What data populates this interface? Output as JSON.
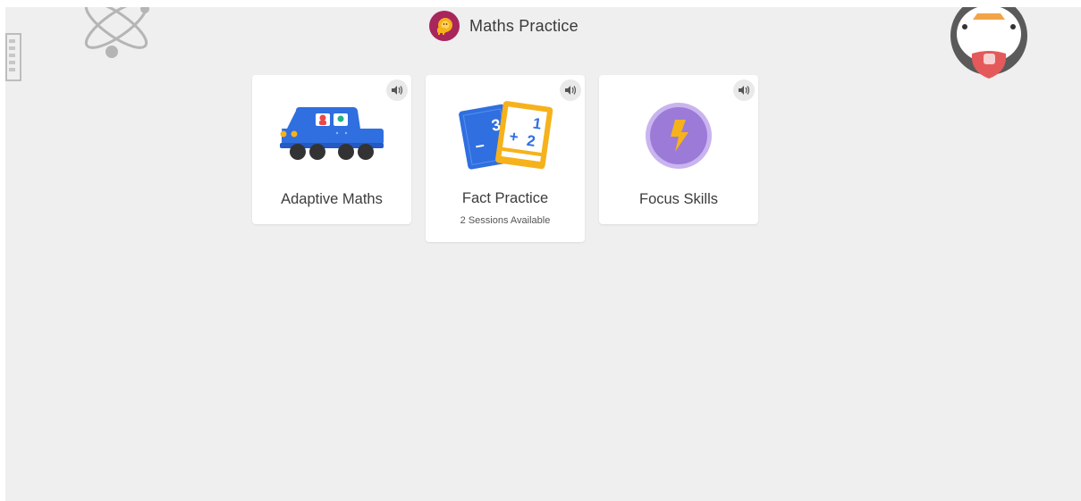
{
  "header": {
    "title": "Maths Practice",
    "icon": "lion-logo-icon",
    "badge_color": "#a8265b"
  },
  "cards": [
    {
      "title": "Adaptive Maths",
      "subtitle": "",
      "icon": "car-icon",
      "accent": "#2f6fe0"
    },
    {
      "title": "Fact Practice",
      "subtitle": "2 Sessions Available",
      "icon": "flashcards-icon",
      "accent": "#f6b21b"
    },
    {
      "title": "Focus Skills",
      "subtitle": "",
      "icon": "lightning-icon",
      "accent": "#9b7ad8"
    }
  ],
  "flashcard_text": {
    "back_top": "3",
    "back_minus": "−",
    "front_top": "1",
    "front_plus": "+",
    "front_bottom": "2"
  },
  "decorations": [
    "atom-icon",
    "ruler-icon",
    "penguin-icon"
  ]
}
